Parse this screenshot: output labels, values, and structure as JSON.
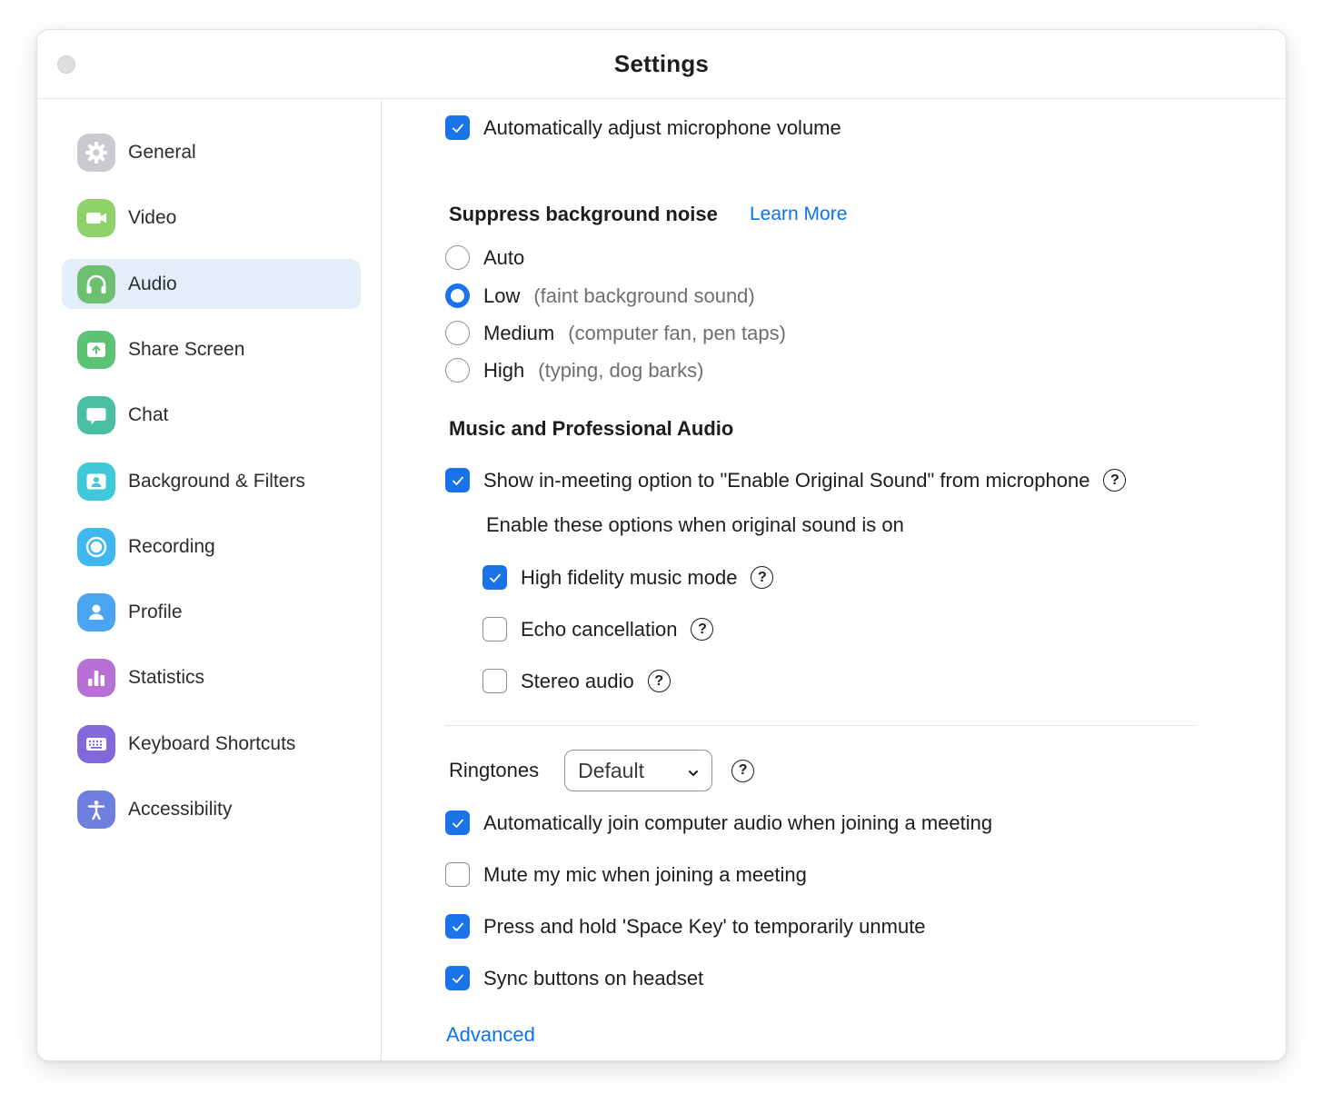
{
  "window": {
    "title": "Settings"
  },
  "sidebar": {
    "items": [
      {
        "label": "General",
        "icon": "gear-icon",
        "color": "#c7c7cc",
        "active": false
      },
      {
        "label": "Video",
        "icon": "video-camera-icon",
        "color": "#8fd26a",
        "active": false
      },
      {
        "label": "Audio",
        "icon": "headphones-icon",
        "color": "#6cc070",
        "active": true
      },
      {
        "label": "Share Screen",
        "icon": "share-screen-icon",
        "color": "#5cc274",
        "active": false
      },
      {
        "label": "Chat",
        "icon": "chat-bubble-icon",
        "color": "#4bbfa4",
        "active": false
      },
      {
        "label": "Background & Filters",
        "icon": "background-person-icon",
        "color": "#3fc8d8",
        "active": false
      },
      {
        "label": "Recording",
        "icon": "record-icon",
        "color": "#3fb8ef",
        "active": false
      },
      {
        "label": "Profile",
        "icon": "profile-icon",
        "color": "#4aa5f0",
        "active": false
      },
      {
        "label": "Statistics",
        "icon": "bar-chart-icon",
        "color": "#b86fd6",
        "active": false
      },
      {
        "label": "Keyboard Shortcuts",
        "icon": "keyboard-icon",
        "color": "#8169dc",
        "active": false
      },
      {
        "label": "Accessibility",
        "icon": "accessibility-icon",
        "color": "#6f7fe0",
        "active": false
      }
    ]
  },
  "audio": {
    "auto_adjust_mic": {
      "label": "Automatically adjust microphone volume",
      "checked": true
    },
    "suppress_noise": {
      "heading": "Suppress background noise",
      "learn_more": "Learn More",
      "options": [
        {
          "label": "Auto",
          "hint": "",
          "selected": false
        },
        {
          "label": "Low",
          "hint": "(faint background sound)",
          "selected": true
        },
        {
          "label": "Medium",
          "hint": "(computer fan, pen taps)",
          "selected": false
        },
        {
          "label": "High",
          "hint": "(typing, dog barks)",
          "selected": false
        }
      ]
    },
    "music_audio": {
      "heading": "Music and Professional Audio",
      "original_sound": {
        "label": "Show in-meeting option to \"Enable Original Sound\" from microphone",
        "checked": true
      },
      "options_caption": "Enable these options when original sound is on",
      "high_fidelity": {
        "label": "High fidelity music mode",
        "checked": true
      },
      "echo_cancellation": {
        "label": "Echo cancellation",
        "checked": false
      },
      "stereo_audio": {
        "label": "Stereo audio",
        "checked": false
      }
    },
    "ringtones": {
      "label": "Ringtones",
      "value": "Default"
    },
    "auto_join": {
      "label": "Automatically join computer audio when joining a meeting",
      "checked": true
    },
    "mute_on_join": {
      "label": "Mute my mic when joining a meeting",
      "checked": false
    },
    "space_unmute": {
      "label": "Press and hold 'Space Key' to temporarily unmute",
      "checked": true
    },
    "sync_headset": {
      "label": "Sync buttons on headset",
      "checked": true
    },
    "advanced_link": "Advanced"
  },
  "help_glyph": "?",
  "accent_color": "#1a73e8"
}
